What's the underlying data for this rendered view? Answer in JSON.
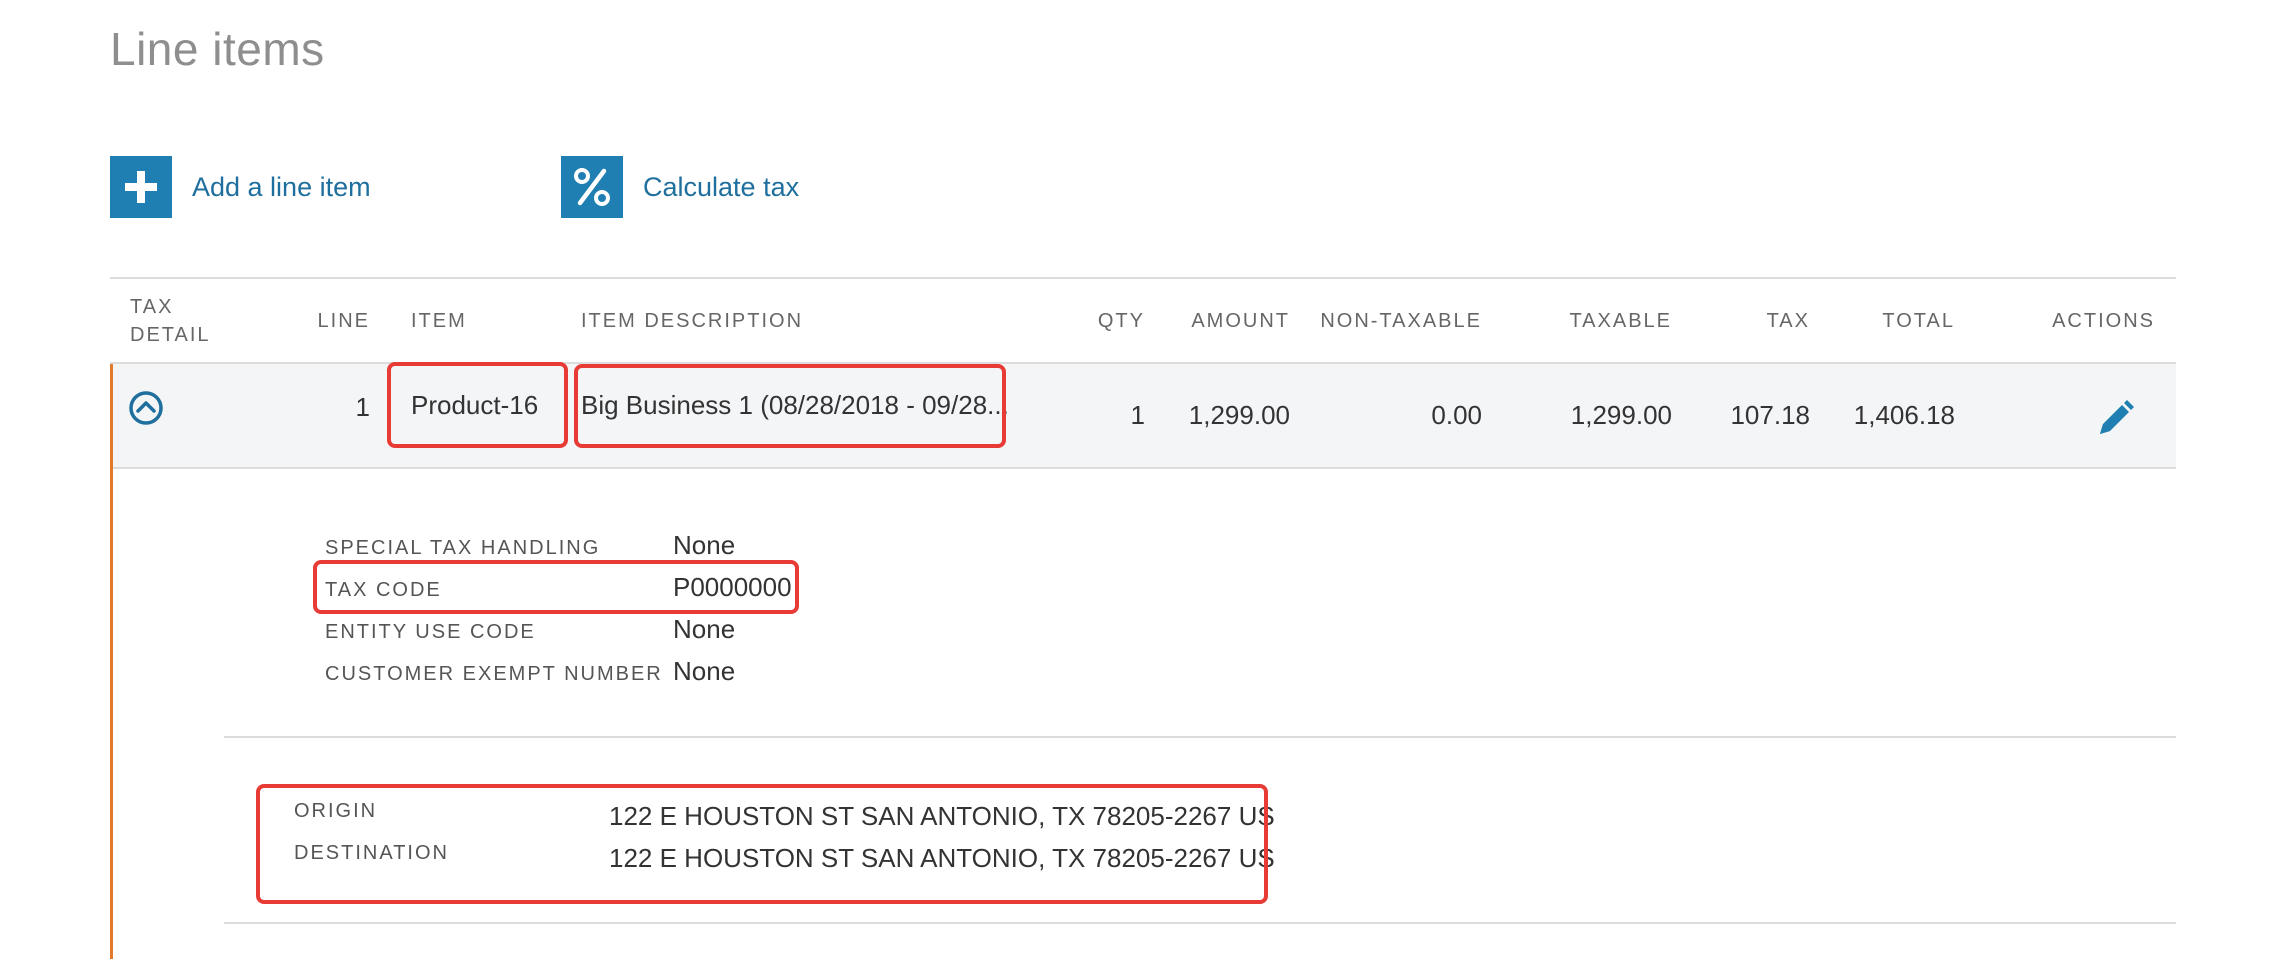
{
  "page": {
    "title": "Line items"
  },
  "actions": {
    "add_line_item": "Add a line item",
    "calculate_tax": "Calculate tax"
  },
  "table": {
    "headers": {
      "tax_detail_1": "TAX",
      "tax_detail_2": "DETAIL",
      "line": "LINE",
      "item": "ITEM",
      "item_description": "ITEM DESCRIPTION",
      "qty": "QTY",
      "amount": "AMOUNT",
      "non_taxable": "NON-TAXABLE",
      "taxable": "TAXABLE",
      "tax": "TAX",
      "total": "TOTAL",
      "actions": "ACTIONS"
    },
    "rows": [
      {
        "line": "1",
        "item": "Product-16",
        "description": "Big Business 1 (08/28/2018 - 09/28...",
        "qty": "1",
        "amount": "1,299.00",
        "non_taxable": "0.00",
        "taxable": "1,299.00",
        "tax": "107.18",
        "total": "1,406.18"
      }
    ]
  },
  "tax_details": {
    "special_tax_handling": {
      "label": "SPECIAL TAX HANDLING",
      "value": "None"
    },
    "tax_code": {
      "label": "TAX CODE",
      "value": "P0000000"
    },
    "entity_use_code": {
      "label": "ENTITY USE CODE",
      "value": "None"
    },
    "customer_exempt_number": {
      "label": "CUSTOMER EXEMPT NUMBER",
      "value": "None"
    }
  },
  "addresses": {
    "origin": {
      "label": "ORIGIN",
      "value": "122 E HOUSTON ST SAN ANTONIO, TX 78205-2267 US"
    },
    "destination": {
      "label": "DESTINATION",
      "value": "122 E HOUSTON ST SAN ANTONIO, TX 78205-2267 US"
    }
  },
  "colors": {
    "accent": "#1f7fb2",
    "highlight": "#e83b35",
    "detail_bar": "#e27a2b"
  },
  "icons": [
    "plus-icon",
    "percent-icon",
    "chevron-up-circle-icon",
    "pencil-icon"
  ]
}
